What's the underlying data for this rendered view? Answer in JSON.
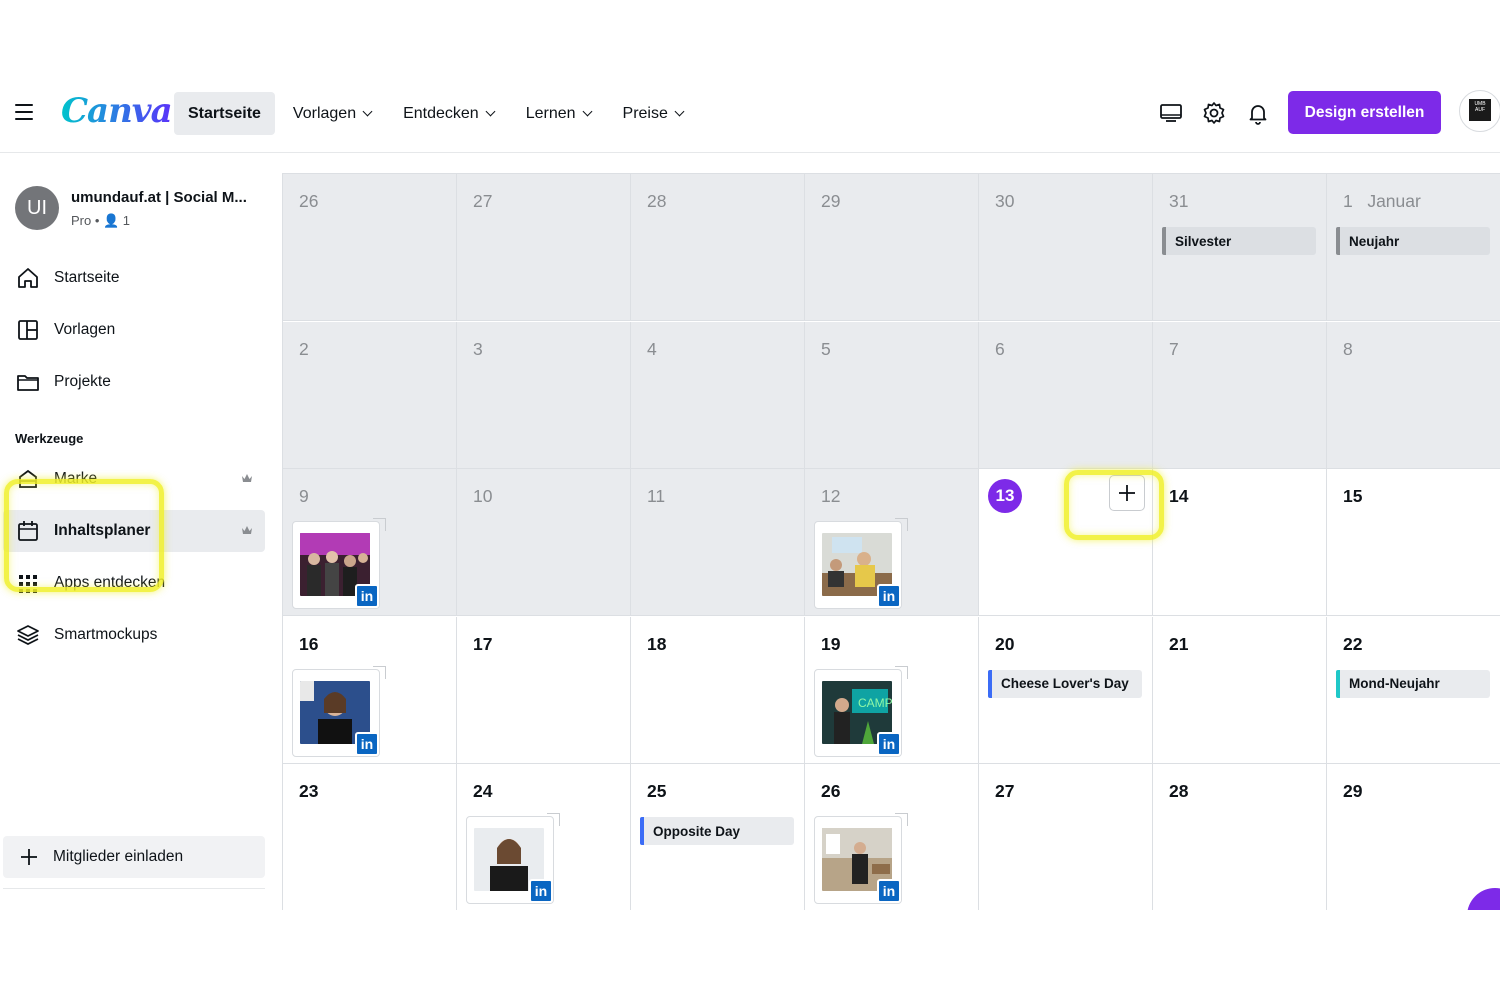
{
  "topbar": {
    "logo": "Canva",
    "nav": [
      {
        "label": "Startseite",
        "active": true,
        "dropdown": false
      },
      {
        "label": "Vorlagen",
        "active": false,
        "dropdown": true
      },
      {
        "label": "Entdecken",
        "active": false,
        "dropdown": true
      },
      {
        "label": "Lernen",
        "active": false,
        "dropdown": true
      },
      {
        "label": "Preise",
        "active": false,
        "dropdown": true
      }
    ],
    "create_label": "Design erstellen",
    "avatar_text": "UMB AUF",
    "icons": [
      "monitor-icon",
      "gear-icon",
      "bell-icon"
    ],
    "accent_color": "#7d2ae8"
  },
  "sidebar": {
    "account": {
      "initials": "UI",
      "name": "umundauf.at | Social M...",
      "meta": "Pro • 👤 1"
    },
    "main_items": [
      {
        "label": "Startseite",
        "icon": "home-icon"
      },
      {
        "label": "Vorlagen",
        "icon": "templates-icon"
      },
      {
        "label": "Projekte",
        "icon": "folder-icon"
      }
    ],
    "tools_title": "Werkzeuge",
    "tool_items": [
      {
        "label": "Marke",
        "icon": "brand-icon",
        "crown": true
      },
      {
        "label": "Inhaltsplaner",
        "icon": "calendar-icon",
        "crown": true,
        "active": true
      },
      {
        "label": "Apps entdecken",
        "icon": "apps-icon",
        "crown": false
      },
      {
        "label": "Smartmockups",
        "icon": "layers-icon",
        "crown": false
      }
    ],
    "invite_label": "Mitglieder einladen"
  },
  "calendar": {
    "today": "13",
    "rows": [
      [
        {
          "day": "26",
          "past": true
        },
        {
          "day": "27",
          "past": true
        },
        {
          "day": "28",
          "past": true
        },
        {
          "day": "29",
          "past": true
        },
        {
          "day": "30",
          "past": true
        },
        {
          "day": "31",
          "past": true,
          "event": {
            "label": "Silvester",
            "color": "#8a8d91"
          }
        },
        {
          "day": "1   Januar",
          "past": true,
          "event": {
            "label": "Neujahr",
            "color": "#8a8d91"
          }
        }
      ],
      [
        {
          "day": "2",
          "past": true
        },
        {
          "day": "3",
          "past": true
        },
        {
          "day": "4",
          "past": true
        },
        {
          "day": "5",
          "past": true
        },
        {
          "day": "6",
          "past": true
        },
        {
          "day": "7",
          "past": true
        },
        {
          "day": "8",
          "past": true
        }
      ],
      [
        {
          "day": "9",
          "past": true,
          "post": "party"
        },
        {
          "day": "10",
          "past": true
        },
        {
          "day": "11",
          "past": true
        },
        {
          "day": "12",
          "past": true,
          "post": "office"
        },
        {
          "day": "13",
          "today": true
        },
        {
          "day": "14"
        },
        {
          "day": "15"
        }
      ],
      [
        {
          "day": "16",
          "post": "portrait-blue"
        },
        {
          "day": "17"
        },
        {
          "day": "18"
        },
        {
          "day": "19",
          "post": "neon"
        },
        {
          "day": "20",
          "event": {
            "label": "Cheese Lover's Day",
            "color": "#3b6cf6"
          }
        },
        {
          "day": "21"
        },
        {
          "day": "22",
          "event": {
            "label": "Mond-Neujahr",
            "color": "#1fc8c8"
          }
        }
      ],
      [
        {
          "day": "23"
        },
        {
          "day": "24",
          "post": "portrait-dark"
        },
        {
          "day": "25",
          "event": {
            "label": "Opposite Day",
            "color": "#3b6cf6"
          }
        },
        {
          "day": "26",
          "post": "office2"
        },
        {
          "day": "27"
        },
        {
          "day": "28"
        },
        {
          "day": "29"
        }
      ]
    ],
    "social_badge": "in"
  }
}
